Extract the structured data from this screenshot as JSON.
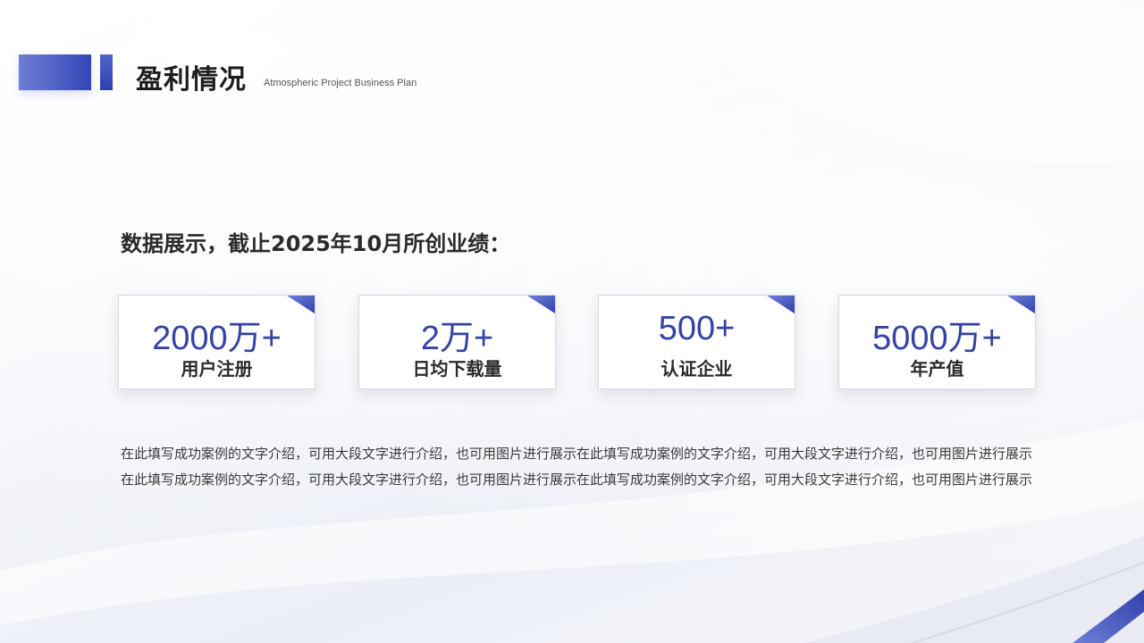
{
  "header": {
    "title": "盈利情况",
    "subtitle": "Atmospheric Project Business Plan"
  },
  "section_heading": "数据展示，截止2025年10月所创业绩：",
  "cards": [
    {
      "value": "2000万+",
      "label": "用户注册"
    },
    {
      "value": "2万+",
      "label": "日均下载量"
    },
    {
      "value": "500+",
      "label": "认证企业"
    },
    {
      "value": "5000万+",
      "label": "年产值"
    }
  ],
  "body_text": "在此填写成功案例的文字介绍，可用大段文字进行介绍，也可用图片进行展示在此填写成功案例的文字介绍，可用大段文字进行介绍，也可用图片进行展示在此填写成功案例的文字介绍，可用大段文字进行介绍，也可用图片进行展示在此填写成功案例的文字介绍，可用大段文字进行介绍，也可用图片进行展示",
  "colors": {
    "accent": "#3443a4",
    "accent_light": "#6f7fd6",
    "text": "#2a2a2a"
  }
}
